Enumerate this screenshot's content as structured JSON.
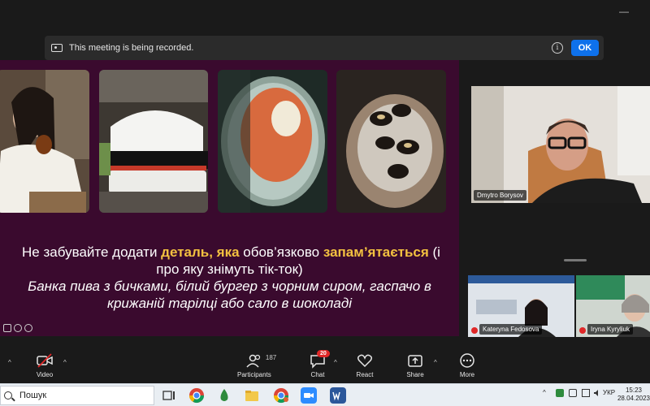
{
  "recording_banner": {
    "text": "This meeting is being recorded.",
    "info_glyph": "i",
    "ok_label": "OK"
  },
  "slide": {
    "line1_pre": "Не забувайте додати ",
    "line1_hl1": "деталь, яка",
    "line1_mid": " обов’язково ",
    "line1_hl2": "запам’ятається",
    "line1_post": " (і",
    "line2": "про яку знімуть тік-ток)",
    "line3": "Банка пива з бичками, білий бургер з чорним сиром, гаспачо в",
    "line4": "крижаній тарілці або сало в шоколаді"
  },
  "participants": {
    "main": {
      "name": "Dmytro Borysov"
    },
    "small": [
      {
        "name": "Kateryna Fedosova"
      },
      {
        "name": "Iryna Kyryliuk"
      }
    ]
  },
  "toolbar": {
    "video_label": "Video",
    "participants_label": "Participants",
    "participants_count": "187",
    "chat_label": "Chat",
    "chat_badge": "20",
    "react_label": "React",
    "share_label": "Share",
    "more_label": "More",
    "caret": "^"
  },
  "taskbar": {
    "search_placeholder": "Пошук",
    "language": "УКР",
    "time": "15:23",
    "date": "28.04.2023"
  },
  "colors": {
    "slide_bg": "#3a0a2e",
    "highlight": "#f3c140",
    "ok_button": "#0e71eb",
    "badge_red": "#e02828"
  }
}
